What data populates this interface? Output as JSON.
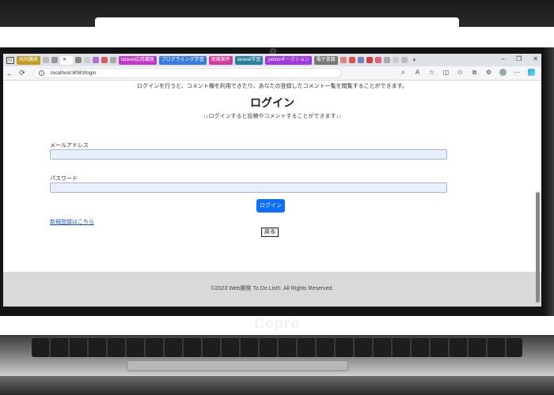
{
  "browser": {
    "tabs": [
      {
        "label": "共同講座",
        "color": "#c49a2a"
      },
      {
        "label": "laravel応用講座",
        "color": "#c03ac7"
      },
      {
        "label": "プログラミング学習",
        "color": "#3a7be0"
      },
      {
        "label": "実務案件",
        "color": "#d33aa0"
      },
      {
        "label": "laravel学習",
        "color": "#2a7fa0"
      },
      {
        "label": "yahooオークション",
        "color": "#a03ae0"
      },
      {
        "label": "電子書籍",
        "color": "#777777"
      }
    ],
    "new_tab": "+",
    "url": "localhost:8080/login",
    "back": "←",
    "reload": "⟳",
    "window_minimize": "–",
    "window_maximize": "❐",
    "window_close": "✕"
  },
  "page": {
    "notice": "ログインを行うと、コメント欄を利用できたり、あなたの登録したコメント一覧を閲覧することができます。",
    "title": "ログイン",
    "subnote": "↓↓ログインすると投稿やコメントすることができます↓↓",
    "email_label": "メールアドレス",
    "email_value": "",
    "password_label": "パスワード",
    "password_value": "",
    "login_button": "ログイン",
    "register_link": "新規登録はこちら",
    "back_button": "戻る",
    "footer": "©2023 Web開発 To Do List!!. All Rights Reserved."
  },
  "laptop": {
    "brand": "Copre"
  },
  "colors": {
    "primary_button": "#0d6efd",
    "input_bg": "#e8f0fe",
    "footer_bg": "#d9d9d9",
    "link": "#1a55c4"
  },
  "icons": [
    "tab-actions-icon",
    "back-arrow-icon",
    "reload-icon",
    "site-info-icon",
    "favorites-icon",
    "extensions-icon",
    "profile-avatar-icon",
    "copilot-icon"
  ]
}
